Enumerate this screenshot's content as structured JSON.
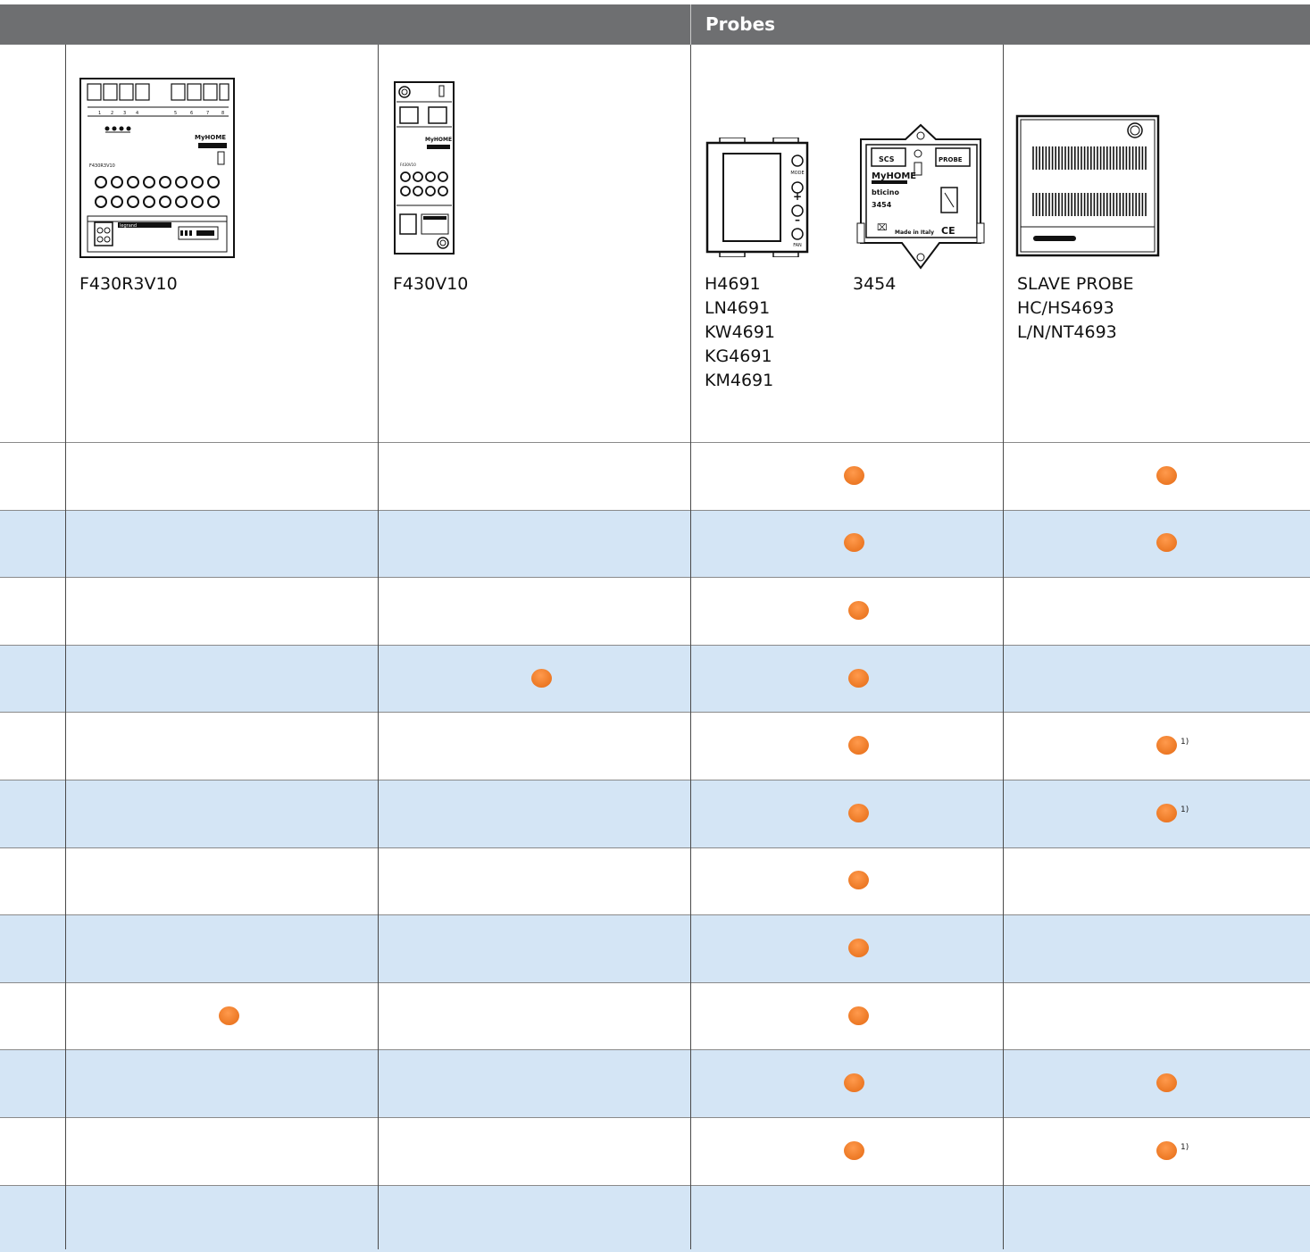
{
  "header": {
    "title": "Probes"
  },
  "products": {
    "col1": {
      "code": "F430R3V10"
    },
    "col2": {
      "code": "F430V10"
    },
    "col3a": {
      "codes": [
        "H4691",
        "LN4691",
        "KW4691",
        "KG4691",
        "KM4691"
      ]
    },
    "col3b": {
      "code": "3454"
    },
    "col4": {
      "codes": [
        "SLAVE PROBE",
        "HC/HS4693",
        "L/N/NT4693"
      ]
    }
  },
  "device_text": {
    "myhome": "MyHOME",
    "bticino": "bticino",
    "scs": "SCS",
    "probe": "PROBE",
    "model_3454": "3454",
    "made_in_italy": "Made in Italy",
    "ce": "CE",
    "mode": "MODE",
    "fan": "FAN",
    "plus": "+",
    "minus": "–",
    "f430r3v10_label": "F430R3V10",
    "f430v10_label": "F430V10",
    "legrand": "legrand"
  },
  "matrix": {
    "colors": {
      "dot": "#f07f2c",
      "band": "#d4e5f5",
      "header": "#6e6f71"
    },
    "note_label": "1)",
    "rows": [
      {
        "col1": false,
        "col2": false,
        "col3": true,
        "col4": true,
        "col4_note": false
      },
      {
        "col1": false,
        "col2": false,
        "col3": true,
        "col4": true,
        "col4_note": false
      },
      {
        "col1": false,
        "col2": false,
        "col3": true,
        "col4": false,
        "col4_note": false
      },
      {
        "col1": false,
        "col2": true,
        "col3": true,
        "col4": false,
        "col4_note": false
      },
      {
        "col1": false,
        "col2": false,
        "col3": true,
        "col4": true,
        "col4_note": true
      },
      {
        "col1": false,
        "col2": false,
        "col3": true,
        "col4": true,
        "col4_note": true
      },
      {
        "col1": false,
        "col2": false,
        "col3": true,
        "col4": false,
        "col4_note": false
      },
      {
        "col1": false,
        "col2": false,
        "col3": true,
        "col4": false,
        "col4_note": false
      },
      {
        "col1": true,
        "col2": false,
        "col3": true,
        "col4": false,
        "col4_note": false
      },
      {
        "col1": false,
        "col2": false,
        "col3": true,
        "col4": true,
        "col4_note": false
      },
      {
        "col1": false,
        "col2": false,
        "col3": true,
        "col4": true,
        "col4_note": true
      },
      {
        "col1": false,
        "col2": false,
        "col3": false,
        "col4": false,
        "col4_note": false
      }
    ]
  }
}
